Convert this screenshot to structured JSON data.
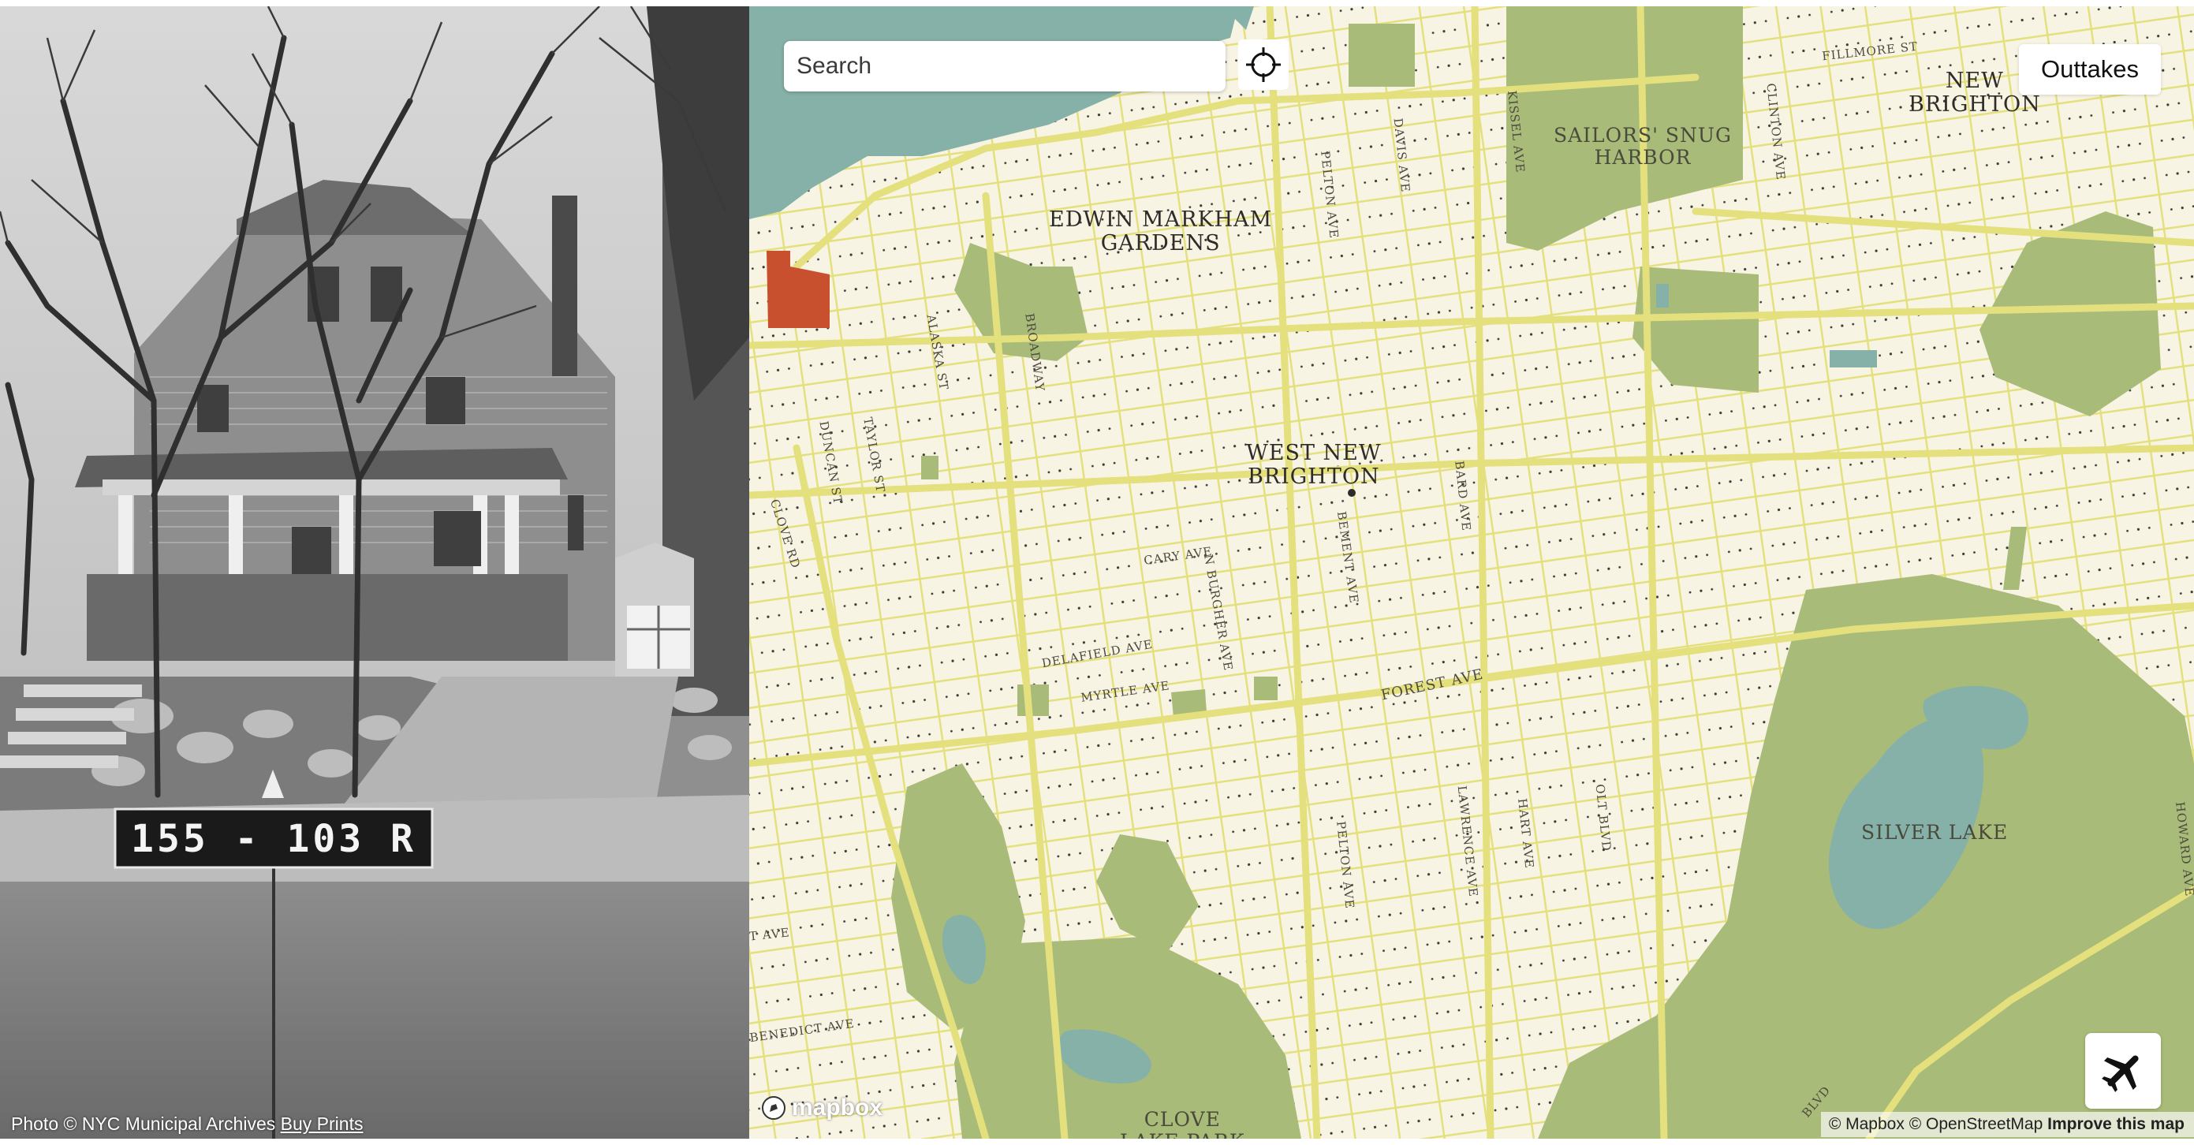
{
  "photo": {
    "sign_text": "155 - 103 R",
    "credit_text": "Photo © NYC Municipal Archives",
    "buy_prints_label": "Buy Prints"
  },
  "map": {
    "search": {
      "placeholder": "Search"
    },
    "outtakes_label": "Outtakes",
    "neighborhoods": {
      "new_brighton": [
        "NEW",
        "BRIGHTON"
      ],
      "edwin_markham": [
        "EDWIN MARKHAM",
        "GARDENS"
      ],
      "west_new_brighton": [
        "WEST NEW",
        "BRIGHTON"
      ],
      "sailors_snug_harbor": [
        "SAILORS' SNUG",
        "HARBOR"
      ],
      "silver_lake": "SILVER LAKE",
      "clove_lake_park": [
        "CLOVE",
        "LAKE PARK"
      ]
    },
    "streets": {
      "fillmore": "FILLMORE ST",
      "kissel": "KISSEL AVE",
      "davis": "DAVIS AVE",
      "pelton_north": "PELTON AVE",
      "clinton": "CLINTON AVE",
      "broadway": "BROADWAY",
      "alaska": "ALASKA ST",
      "taylor": "TAYLOR ST",
      "duncan": "DUNCAN ST",
      "clove_rd": "CLOVE RD",
      "cary": "CARY AVE",
      "n_burgher": "N BURGHER AVE",
      "bement": "BEMENT AVE",
      "bard": "BARD AVE",
      "delafield": "DELAFIELD AVE",
      "myrtle": "MYRTLE AVE",
      "forest": "FOREST AVE",
      "hart": "HART AVE",
      "oakland": "OLT BLVD",
      "lawrence": "LAWRENCE AVE",
      "pelton_south": "PELTON AVE",
      "howard": "HOWARD AVE",
      "benedict": "BENEDICT AVE",
      "left_ave": "T AVE",
      "blvd": "BLVD"
    },
    "mapbox_logo": "mapbox",
    "attribution": {
      "mapbox": "© Mapbox",
      "osm": "© OpenStreetMap",
      "improve": "Improve this map"
    }
  },
  "colors": {
    "land": "#f8f4e4",
    "road": "#e3e07d",
    "park": "#a9bb78",
    "water": "#86b1a8",
    "highlight": "#c9502e"
  },
  "icons": {
    "close": "close-icon",
    "locate": "crosshair-icon",
    "aerial": "airplane-icon"
  }
}
